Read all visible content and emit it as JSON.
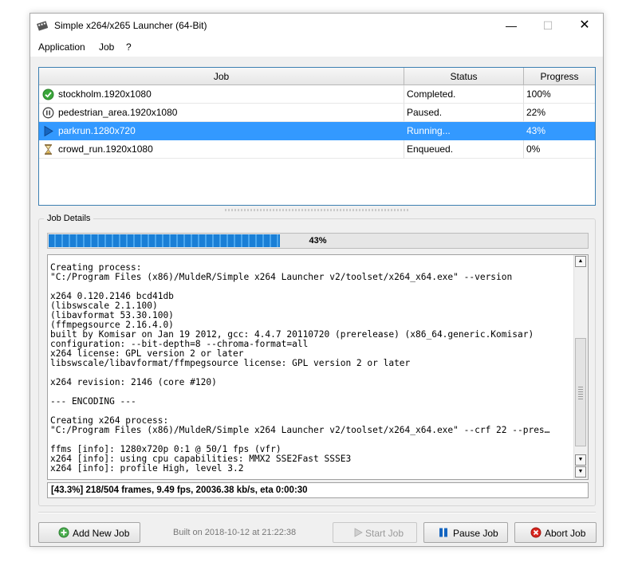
{
  "window": {
    "title": "Simple x264/x265 Launcher (64-Bit)",
    "controls": {
      "minimize": "—",
      "maximize": "☐",
      "close": "✕"
    }
  },
  "menu": [
    "Application",
    "Job",
    "?"
  ],
  "jobs": {
    "headers": [
      "Job",
      "Status",
      "Progress"
    ],
    "rows": [
      {
        "name": "stockholm.1920x1080",
        "status": "Completed.",
        "progress": "100%",
        "icon": "completed-check-icon"
      },
      {
        "name": "pedestrian_area.1920x1080",
        "status": "Paused.",
        "progress": "22%",
        "icon": "paused-icon"
      },
      {
        "name": "parkrun.1280x720",
        "status": "Running...",
        "progress": "43%",
        "icon": "running-play-icon"
      },
      {
        "name": "crowd_run.1920x1080",
        "status": "Enqueued.",
        "progress": "0%",
        "icon": "hourglass-icon"
      }
    ],
    "selected_index": 2
  },
  "details": {
    "group_label": "Job Details",
    "progress_value": 0.43,
    "progress_text": "43%",
    "log_lines": [
      "Creating process:",
      "\"C:/Program Files (x86)/MuldeR/Simple x264 Launcher v2/toolset/x264_x64.exe\" --version",
      "",
      "x264 0.120.2146 bcd41db",
      "(libswscale 2.1.100)",
      "(libavformat 53.30.100)",
      "(ffmpegsource 2.16.4.0)",
      "built by Komisar on Jan 19 2012, gcc: 4.4.7 20110720 (prerelease) (x86_64.generic.Komisar)",
      "configuration: --bit-depth=8 --chroma-format=all",
      "x264 license: GPL version 2 or later",
      "libswscale/libavformat/ffmpegsource license: GPL version 2 or later",
      "",
      "x264 revision: 2146 (core #120)",
      "",
      "--- ENCODING ---",
      "",
      "Creating x264 process:",
      "\"C:/Program Files (x86)/MuldeR/Simple x264 Launcher v2/toolset/x264_x64.exe\" --crf 22 --pres…",
      "",
      "ffms [info]: 1280x720p 0:1 @ 50/1 fps (vfr)",
      "x264 [info]: using cpu capabilities: MMX2 SSE2Fast SSSE3",
      "x264 [info]: profile High, level 3.2"
    ],
    "status_line": "[43.3%] 218/504 frames, 9.49 fps, 20036.38 kb/s, eta 0:00:30"
  },
  "footer": {
    "add_job": "Add New Job",
    "built": "Built on 2018-10-12 at 21:22:38",
    "start_job": "Start Job",
    "pause_job": "Pause Job",
    "abort_job": "Abort Job"
  },
  "colors": {
    "selection": "#3399ff",
    "progress_fill": "#1a7fd6",
    "completed": "#3aa63a",
    "abort": "#d9251e"
  }
}
